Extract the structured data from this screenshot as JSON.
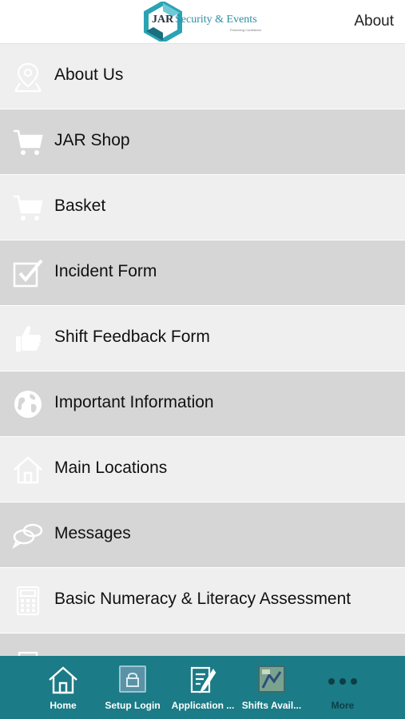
{
  "header": {
    "logo_jar": "JAR",
    "logo_rest": "Security & Events",
    "logo_tagline": "Protecting Confidence",
    "about_label": "About"
  },
  "menu": {
    "items": [
      {
        "label": "About Us",
        "icon": "map-pin-icon"
      },
      {
        "label": "JAR Shop",
        "icon": "cart-icon"
      },
      {
        "label": "Basket",
        "icon": "cart-icon"
      },
      {
        "label": "Incident Form",
        "icon": "checkbox-icon"
      },
      {
        "label": "Shift Feedback Form",
        "icon": "thumbs-up-icon"
      },
      {
        "label": "Important Information",
        "icon": "globe-icon"
      },
      {
        "label": "Main Locations",
        "icon": "home-icon"
      },
      {
        "label": "Messages",
        "icon": "chat-bubbles-icon"
      },
      {
        "label": "Basic Numeracy & Literacy Assessment",
        "icon": "calculator-icon"
      }
    ]
  },
  "tabbar": {
    "tabs": [
      {
        "label": "Home",
        "icon": "home-icon"
      },
      {
        "label": "Setup Login",
        "icon": "setup-login-thumbnail"
      },
      {
        "label": "Application ...",
        "icon": "edit-document-icon"
      },
      {
        "label": "Shifts Avail...",
        "icon": "shifts-thumbnail"
      },
      {
        "label": "More",
        "icon": "more-dots-icon"
      }
    ]
  },
  "colors": {
    "row_light": "#efefef",
    "row_dark": "#d6d6d6",
    "tabbar": "#1b7b86",
    "brand_teal": "#2a8fa0"
  }
}
